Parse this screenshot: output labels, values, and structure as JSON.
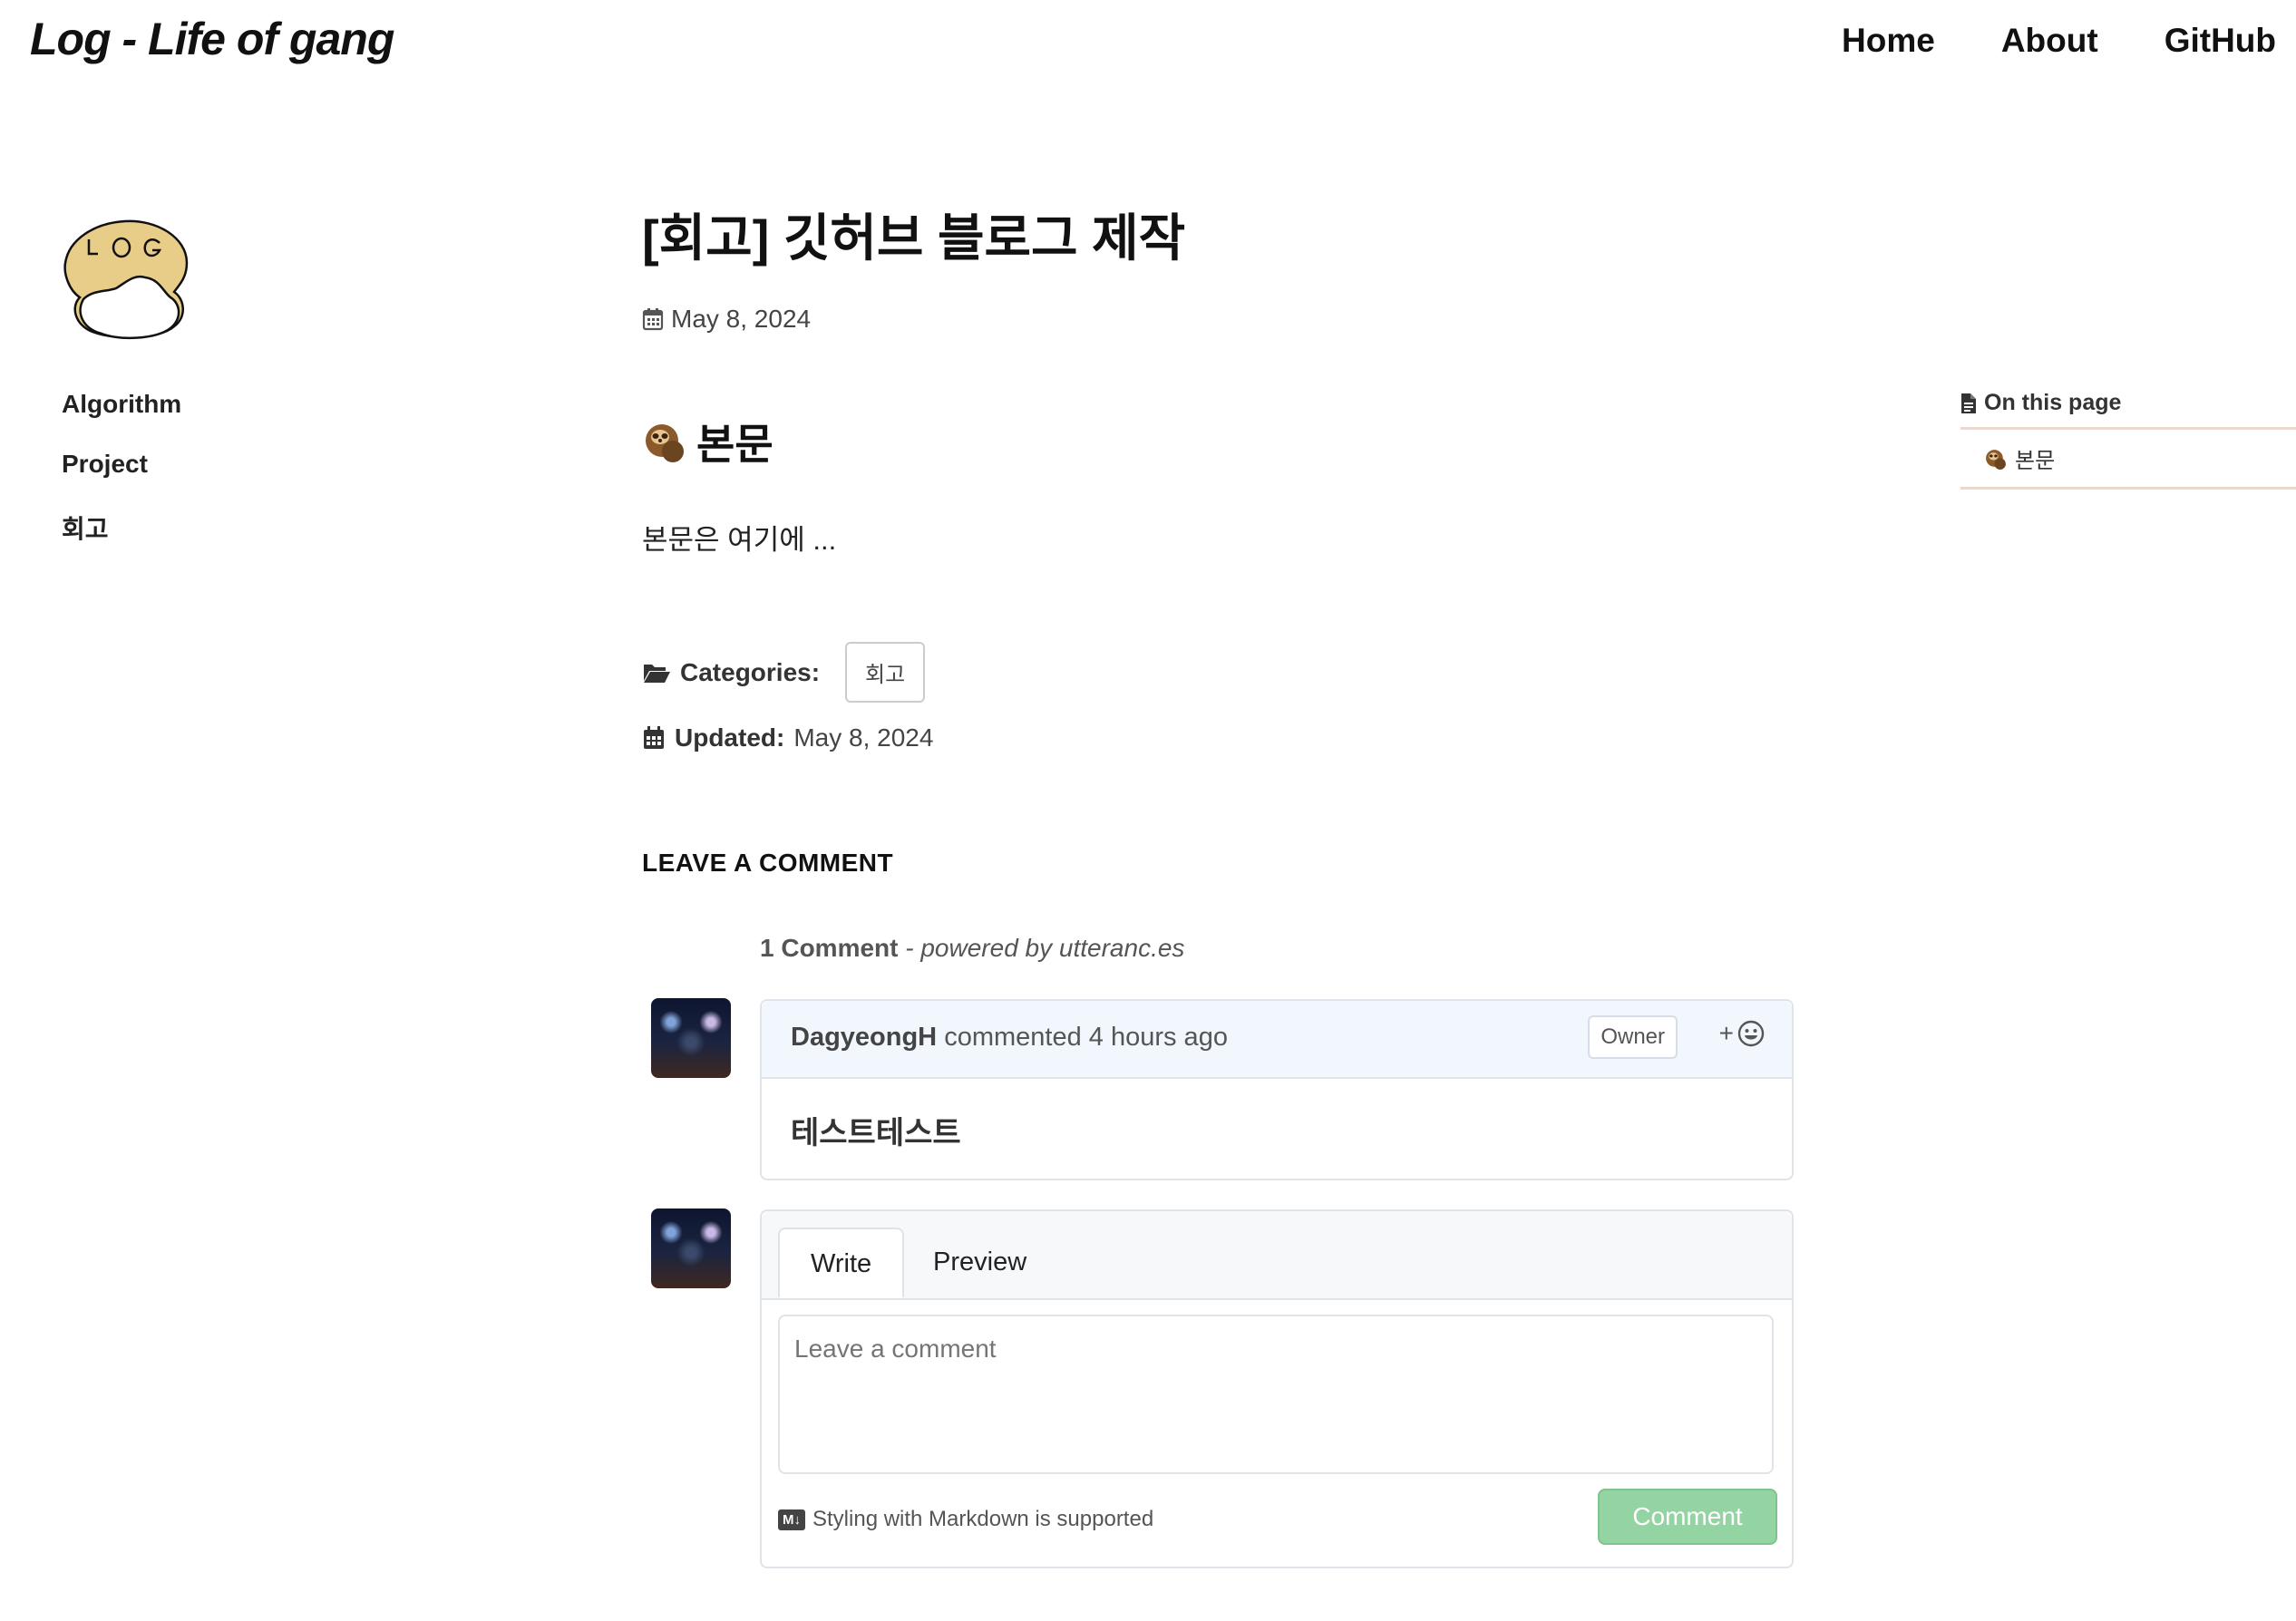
{
  "masthead": {
    "title": "Log - Life of gang",
    "nav": [
      {
        "label": "Home"
      },
      {
        "label": "About"
      },
      {
        "label": "GitHub"
      }
    ]
  },
  "sidebar": {
    "logo_icon": "log-cat-logo-icon",
    "items": [
      {
        "label": "Algorithm"
      },
      {
        "label": "Project"
      },
      {
        "label": "회고"
      }
    ]
  },
  "post": {
    "title": "[회고] 깃허브 블로그 제작",
    "date": "May 8, 2024",
    "section_heading": "본문",
    "section_icon": "sloth-emoji-icon",
    "body": "본문은 여기에 ...",
    "categories_label": "Categories:",
    "category_tag": "회고",
    "updated_label": "Updated:",
    "updated_date": "May 8, 2024",
    "leave_comment_heading": "LEAVE A COMMENT"
  },
  "comments": {
    "count_label": "1 Comment",
    "powered_by": "- powered by utteranc.es",
    "items": [
      {
        "author": "DagyeongH",
        "meta": "commented 4 hours ago",
        "badge": "Owner",
        "body": "테스트테스트"
      }
    ],
    "editor": {
      "tabs": [
        {
          "label": "Write"
        },
        {
          "label": "Preview"
        }
      ],
      "placeholder": "Leave a comment",
      "markdown_badge": "M↓",
      "markdown_note": "Styling with Markdown is supported",
      "submit_label": "Comment"
    }
  },
  "toc": {
    "title": "On this page",
    "items": [
      {
        "label": "본문"
      }
    ]
  },
  "colors": {
    "toc_border": "#f3d7c3",
    "comment_header_bg": "#f1f7fd",
    "submit_button": "#94d3a2"
  }
}
